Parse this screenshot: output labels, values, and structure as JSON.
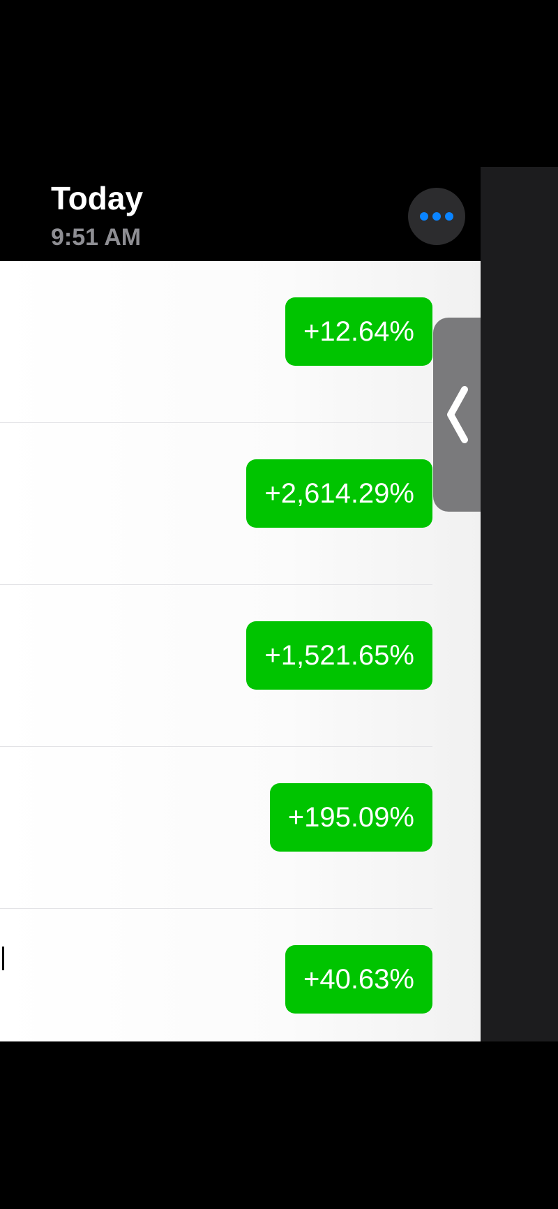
{
  "header": {
    "title": "Today",
    "time": "9:51 AM",
    "more_icon": "ellipsis-icon"
  },
  "colors": {
    "gain_green": "#00c400",
    "more_dots_blue": "#0a84ff",
    "panel_dark": "#1c1c1e"
  },
  "rows": [
    {
      "change": "+12.64%"
    },
    {
      "change": "+2,614.29%"
    },
    {
      "change": "+1,521.65%"
    },
    {
      "change": "+195.09%"
    },
    {
      "change": "+40.63%"
    }
  ],
  "handle": {
    "icon": "chevron-left-icon"
  }
}
